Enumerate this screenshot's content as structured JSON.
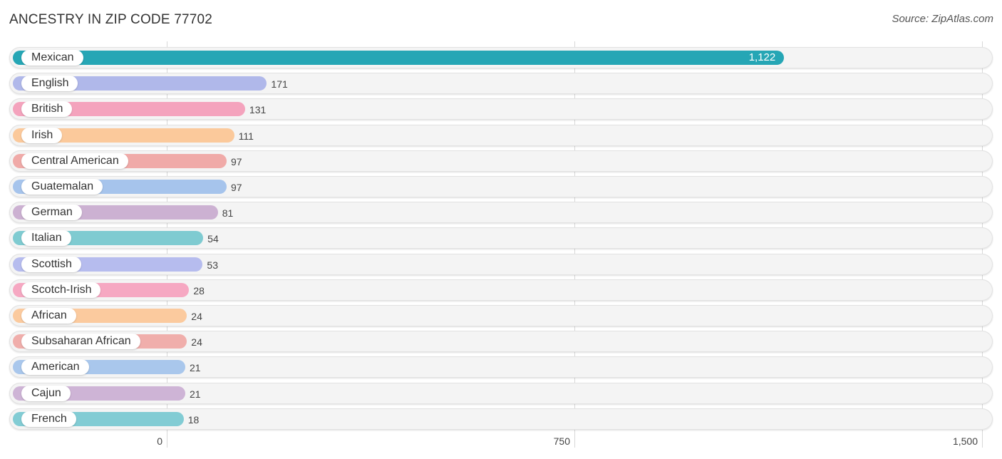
{
  "header": {
    "title": "ANCESTRY IN ZIP CODE 77702",
    "source": "Source: ZipAtlas.com"
  },
  "chart_data": {
    "type": "bar",
    "orientation": "horizontal",
    "title": "ANCESTRY IN ZIP CODE 77702",
    "xlabel": "",
    "ylabel": "",
    "xlim": [
      0,
      1500
    ],
    "x_ticks": [
      0,
      750,
      1500
    ],
    "x_tick_labels": [
      "0",
      "750",
      "1,500"
    ],
    "grid": true,
    "categories": [
      "Mexican",
      "English",
      "British",
      "Irish",
      "Central American",
      "Guatemalan",
      "German",
      "Italian",
      "Scottish",
      "Scotch-Irish",
      "African",
      "Subsaharan African",
      "American",
      "Cajun",
      "French"
    ],
    "values": [
      1122,
      171,
      131,
      111,
      97,
      97,
      81,
      54,
      53,
      28,
      24,
      24,
      21,
      21,
      18
    ],
    "value_labels": [
      "1,122",
      "171",
      "131",
      "111",
      "97",
      "97",
      "81",
      "54",
      "53",
      "28",
      "24",
      "24",
      "21",
      "21",
      "18"
    ],
    "colors": [
      "#26a6b5",
      "#b0b8ea",
      "#f4a3bd",
      "#fbc99b",
      "#f0aaa8",
      "#a6c4ec",
      "#ccb1d2",
      "#7fcbd1",
      "#b6bcee",
      "#f6a8c2",
      "#fbca9e",
      "#f0aeab",
      "#a9c7ec",
      "#ceb4d6",
      "#82ccd4"
    ]
  }
}
